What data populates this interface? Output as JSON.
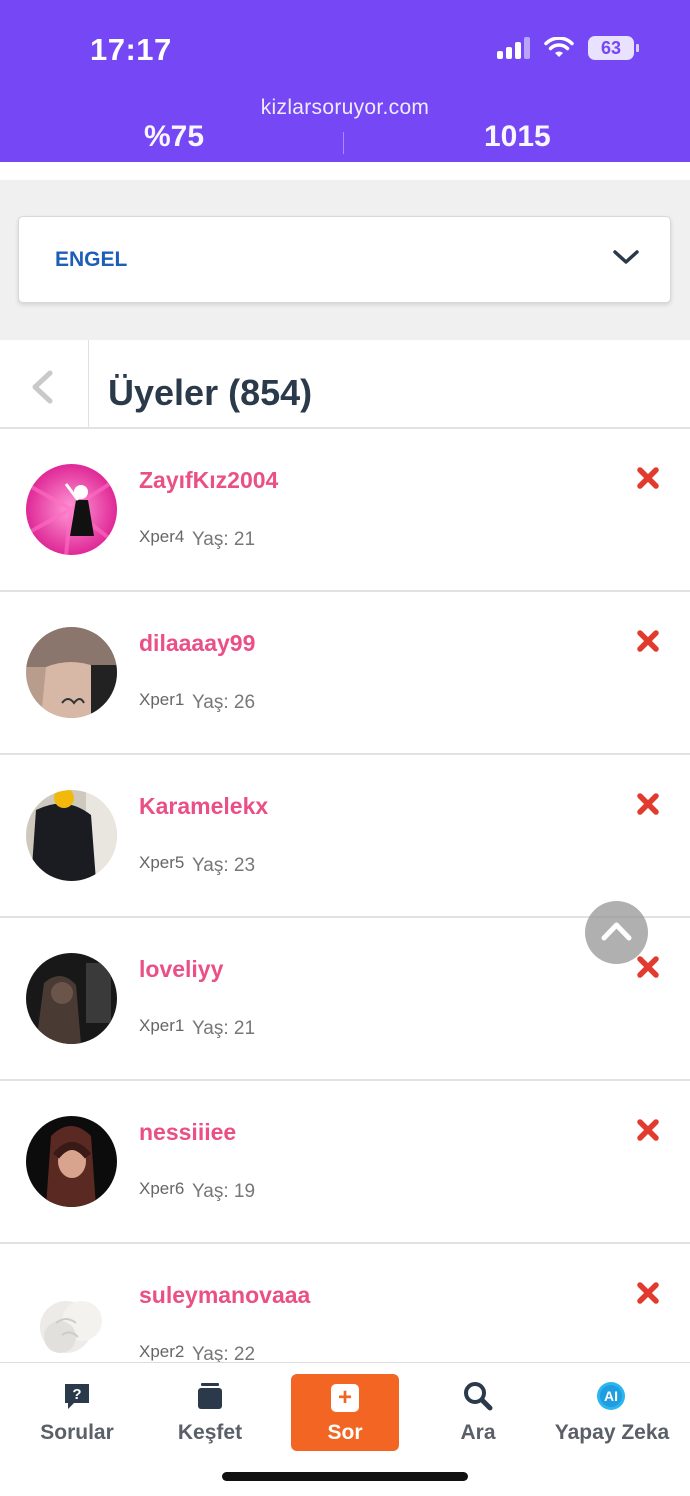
{
  "status_bar": {
    "time": "17:17",
    "battery": "63"
  },
  "header": {
    "url": "kizlarsoruyor.com",
    "stat_left": "%75",
    "stat_right": "1015"
  },
  "dropdown": {
    "label": "ENGEL"
  },
  "members": {
    "title": "Üyeler (854)",
    "items": [
      {
        "name": "ZayıfKız2004",
        "level": "Xper4",
        "age": "Yaş: 21"
      },
      {
        "name": "dilaaaay99",
        "level": "Xper1",
        "age": "Yaş: 26"
      },
      {
        "name": "Karamelekx",
        "level": "Xper5",
        "age": "Yaş: 23"
      },
      {
        "name": "loveliyy",
        "level": "Xper1",
        "age": "Yaş: 21"
      },
      {
        "name": "nessiiiee",
        "level": "Xper6",
        "age": "Yaş: 19"
      },
      {
        "name": "suleymanovaaa",
        "level": "Xper2",
        "age": "Yaş: 22"
      }
    ]
  },
  "bottom_nav": {
    "items": [
      {
        "label": "Sorular",
        "icon": "question-bubble-icon"
      },
      {
        "label": "Keşfet",
        "icon": "cards-icon"
      },
      {
        "label": "Sor",
        "icon": "plus-icon"
      },
      {
        "label": "Ara",
        "icon": "search-icon"
      },
      {
        "label": "Yapay Zeka",
        "icon": "ai-icon"
      }
    ]
  },
  "colors": {
    "header_bg": "#7547f5",
    "username": "#ea4f86",
    "remove": "#e03b2e",
    "sor_bg": "#f26522",
    "dropdown_text": "#1d5fb8"
  }
}
